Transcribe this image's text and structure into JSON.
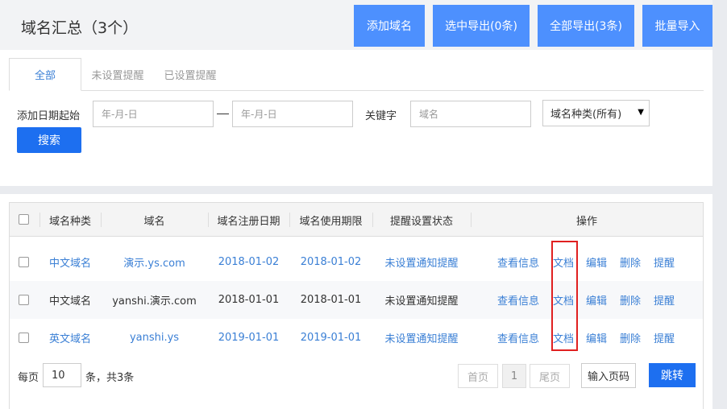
{
  "header": {
    "title": "域名汇总（3个）",
    "buttons": {
      "add": "添加域名",
      "export_selected": "选中导出(0条)",
      "export_all": "全部导出(3条)",
      "bulk_import": "批量导入"
    }
  },
  "tabs": [
    {
      "label": "全部",
      "active": true
    },
    {
      "label": "未设置提醒",
      "active": false
    },
    {
      "label": "已设置提醒",
      "active": false
    }
  ],
  "filter": {
    "date_label": "添加日期起始",
    "date_start_placeholder": "年-月-日",
    "date_end_placeholder": "年-月-日",
    "keyword_label": "关键字",
    "keyword_placeholder": "域名",
    "type_select": "域名种类(所有)",
    "search_button": "搜索"
  },
  "table": {
    "columns": [
      "域名种类",
      "域名",
      "域名注册日期",
      "域名使用期限",
      "提醒设置状态",
      "操作"
    ],
    "actions": [
      "查看信息",
      "文档",
      "编辑",
      "删除",
      "提醒"
    ],
    "rows": [
      {
        "type": "中文域名",
        "domain": "演示.ys.com",
        "reg_date": "2018-01-02",
        "expire_date": "2018-01-02",
        "status": "未设置通知提醒",
        "style": "link"
      },
      {
        "type": "中文域名",
        "domain": "yanshi.演示.com",
        "reg_date": "2018-01-01",
        "expire_date": "2018-01-01",
        "status": "未设置通知提醒",
        "style": "plain"
      },
      {
        "type": "英文域名",
        "domain": "yanshi.ys",
        "reg_date": "2019-01-01",
        "expire_date": "2019-01-01",
        "status": "未设置通知提醒",
        "style": "link"
      }
    ]
  },
  "pagination": {
    "per_page_label": "每页",
    "per_page_value": "10",
    "total_text": "条，共3条",
    "first": "首页",
    "current_page": "1",
    "last": "尾页",
    "goto_placeholder": "输入页码",
    "goto_button": "跳转"
  },
  "colors": {
    "accent": "#4d90fe",
    "primary_button": "#1d6ff0",
    "link": "#3a7fd5",
    "highlight": "#e02020"
  }
}
